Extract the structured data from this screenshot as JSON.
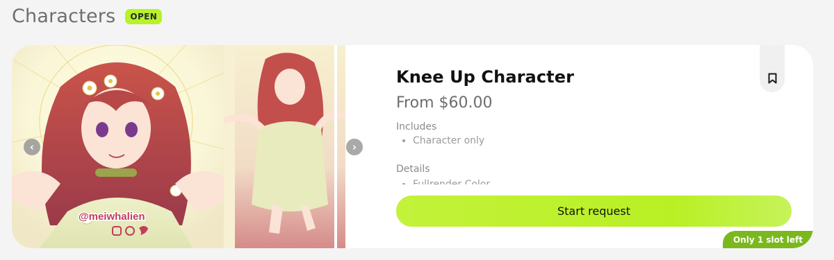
{
  "section": {
    "title": "Characters",
    "status_badge": "OPEN"
  },
  "card": {
    "title": "Knee Up Character",
    "price": "From $60.00",
    "includes_label": "Includes",
    "includes_items": [
      "Character only"
    ],
    "details_label": "Details",
    "details_items": [
      "Fullrender Color"
    ],
    "cta_label": "Start request",
    "slot_badge": "Only 1 slot left"
  },
  "gallery": {
    "watermark_handle": "@meiwhalien",
    "prev_icon": "chevron-left-icon",
    "next_icon": "chevron-right-icon"
  },
  "colors": {
    "accent": "#b8f22a",
    "slot_badge": "#7ab81e",
    "title_gray": "#6e6e6e"
  }
}
